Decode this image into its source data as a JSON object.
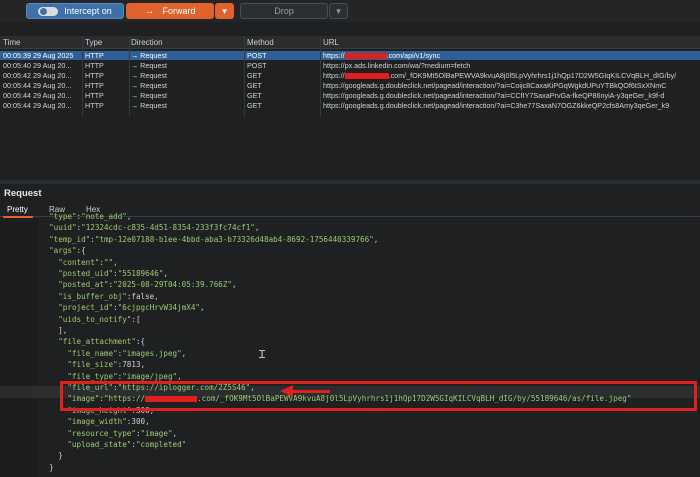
{
  "toolbar": {
    "intercept_label": "Intercept on",
    "forward_label": "Forward",
    "forward_icon": "arrow-right-icon",
    "drop_label": "Drop",
    "dropdown_glyph": "▾"
  },
  "table": {
    "columns": [
      "Time",
      "Type",
      "Direction",
      "Method",
      "URL"
    ],
    "rows": [
      {
        "time": "00:05:39 29 Aug 2025",
        "type": "HTTP",
        "direction": "→  Request",
        "method": "POST",
        "url_prefix": "https://",
        "url_suffix": ".com/api/v1/sync",
        "selected": true
      },
      {
        "time": "00:05:40 29 Aug 20...",
        "type": "HTTP",
        "direction": "→  Request",
        "method": "POST",
        "url": "https://px.ads.linkedin.com/wa/?medium=fetch"
      },
      {
        "time": "00:05:42 29 Aug 20...",
        "type": "HTTP",
        "direction": "→  Request",
        "method": "GET",
        "url_prefix": "https://",
        "url_suffix": ".com/_fOK9Mt5OlBaPEWVA9kvuA8j0l5LpVyhrhrs1j1hQp17D2W5GIqKILCVqBLH_dIG/by/"
      },
      {
        "time": "00:05:44 29 Aug 20...",
        "type": "HTTP",
        "direction": "→  Request",
        "method": "GET",
        "url": "https://googleads.g.doubleclick.net/pagead/interaction/?ai=Coijc8CaxaKiPGqWgkdUPuYTBkQOf6tSxXNmC"
      },
      {
        "time": "00:05:44 29 Aug 20...",
        "type": "HTTP",
        "direction": "→  Request",
        "method": "GET",
        "url": "https://googleads.g.doubleclick.net/pagead/interaction/?ai=CCfIY7SaxaPrvGa-fkeQP86nyiA-y3qeGer_k9f-d"
      },
      {
        "time": "00:05:44 29 Aug 20...",
        "type": "HTTP",
        "direction": "→  Request",
        "method": "GET",
        "url": "https://googleads.g.doubleclick.net/pagead/interaction/?ai=C3he77SaxaN7OGZ6kkeQP2cfs8Amy3qeGer_k9"
      }
    ]
  },
  "request": {
    "title": "Request",
    "tabs": [
      "Pretty",
      "Raw",
      "Hex"
    ]
  },
  "code_lines": [
    {
      "indent": 2,
      "segments": [
        [
          "s",
          "\"type\""
        ],
        [
          "p",
          ":"
        ],
        [
          "s",
          "\"note_add\""
        ],
        [
          "p",
          ","
        ]
      ]
    },
    {
      "indent": 2,
      "segments": [
        [
          "s",
          "\"uuid\""
        ],
        [
          "p",
          ":"
        ],
        [
          "s",
          "\"12324cdc-c835-4d51-8354-233f3fc74cf1\""
        ],
        [
          "p",
          ","
        ]
      ]
    },
    {
      "indent": 2,
      "segments": [
        [
          "s",
          "\"temp_id\""
        ],
        [
          "p",
          ":"
        ],
        [
          "s",
          "\"tmp-12e07188-b1ee-4bbd-aba3-b73326d48ab4-8692-1756440339766\""
        ],
        [
          "p",
          ","
        ]
      ]
    },
    {
      "indent": 2,
      "segments": [
        [
          "s",
          "\"args\""
        ],
        [
          "p",
          ":{"
        ]
      ]
    },
    {
      "indent": 4,
      "segments": [
        [
          "s",
          "\"content\""
        ],
        [
          "p",
          ":"
        ],
        [
          "s",
          "\"\""
        ],
        [
          "p",
          ","
        ]
      ]
    },
    {
      "indent": 4,
      "segments": [
        [
          "s",
          "\"posted_uid\""
        ],
        [
          "p",
          ":"
        ],
        [
          "s",
          "\"55189646\""
        ],
        [
          "p",
          ","
        ]
      ]
    },
    {
      "indent": 4,
      "segments": [
        [
          "s",
          "\"posted_at\""
        ],
        [
          "p",
          ":"
        ],
        [
          "s",
          "\"2025-08-29T04:05:39.766Z\""
        ],
        [
          "p",
          ","
        ]
      ]
    },
    {
      "indent": 4,
      "segments": [
        [
          "s",
          "\"is_buffer_obj\""
        ],
        [
          "p",
          ":false,"
        ]
      ]
    },
    {
      "indent": 4,
      "segments": [
        [
          "s",
          "\"project_id\""
        ],
        [
          "p",
          ":"
        ],
        [
          "s",
          "\"6cjpgcHrvW34jmX4\""
        ],
        [
          "p",
          ","
        ]
      ]
    },
    {
      "indent": 4,
      "segments": [
        [
          "s",
          "\"uids_to_notify\""
        ],
        [
          "p",
          ":["
        ]
      ]
    },
    {
      "indent": 4,
      "segments": [
        [
          "p",
          "],"
        ]
      ]
    },
    {
      "indent": 4,
      "segments": [
        [
          "s",
          "\"file_attachment\""
        ],
        [
          "p",
          ":{"
        ]
      ]
    },
    {
      "indent": 6,
      "segments": [
        [
          "s",
          "\"file_name\""
        ],
        [
          "p",
          ":"
        ],
        [
          "s",
          "\"images.jpeg\""
        ],
        [
          "p",
          ","
        ]
      ]
    },
    {
      "indent": 6,
      "segments": [
        [
          "s",
          "\"file_size\""
        ],
        [
          "p",
          ":7813,"
        ]
      ]
    },
    {
      "indent": 6,
      "segments": [
        [
          "s",
          "\"file_type\""
        ],
        [
          "p",
          ":"
        ],
        [
          "s",
          "\"image/jpeg\""
        ],
        [
          "p",
          ","
        ]
      ]
    },
    {
      "indent": 6,
      "segments": [
        [
          "s",
          "\"file_url\""
        ],
        [
          "p",
          ":"
        ],
        [
          "s",
          "\"https://iplogger.com/2Z5S46\""
        ],
        [
          "p",
          ","
        ]
      ]
    },
    {
      "indent": 6,
      "segments": [
        [
          "s",
          "\"image\""
        ],
        [
          "p",
          ":"
        ],
        [
          "s",
          "\"https://"
        ],
        [
          "r",
          ""
        ],
        [
          "s",
          ".com/_fOK9Mt5OlBaPEWVA9kvuA8j0l5LpVyhrhrs1j1hQp17D2W5GIqKILCVqBLH_dIG/by/55189646/as/file.jpeg\""
        ]
      ]
    },
    {
      "indent": 6,
      "segments": [
        [
          "s",
          "\"image_height\""
        ],
        [
          "p",
          ":300,"
        ]
      ]
    },
    {
      "indent": 6,
      "segments": [
        [
          "s",
          "\"image_width\""
        ],
        [
          "p",
          ":300,"
        ]
      ]
    },
    {
      "indent": 6,
      "segments": [
        [
          "s",
          "\"resource_type\""
        ],
        [
          "p",
          ":"
        ],
        [
          "s",
          "\"image\""
        ],
        [
          "p",
          ","
        ]
      ]
    },
    {
      "indent": 6,
      "segments": [
        [
          "s",
          "\"upload_state\""
        ],
        [
          "p",
          ":"
        ],
        [
          "s",
          "\"completed\""
        ]
      ]
    },
    {
      "indent": 4,
      "segments": [
        [
          "p",
          "}"
        ]
      ]
    },
    {
      "indent": 2,
      "segments": [
        [
          "p",
          "}"
        ]
      ]
    }
  ],
  "colors": {
    "accent_orange": "#e0622c",
    "selected_row": "#2f5f94",
    "highlight_red": "#e01f1f",
    "string_green": "#9ccc74"
  }
}
